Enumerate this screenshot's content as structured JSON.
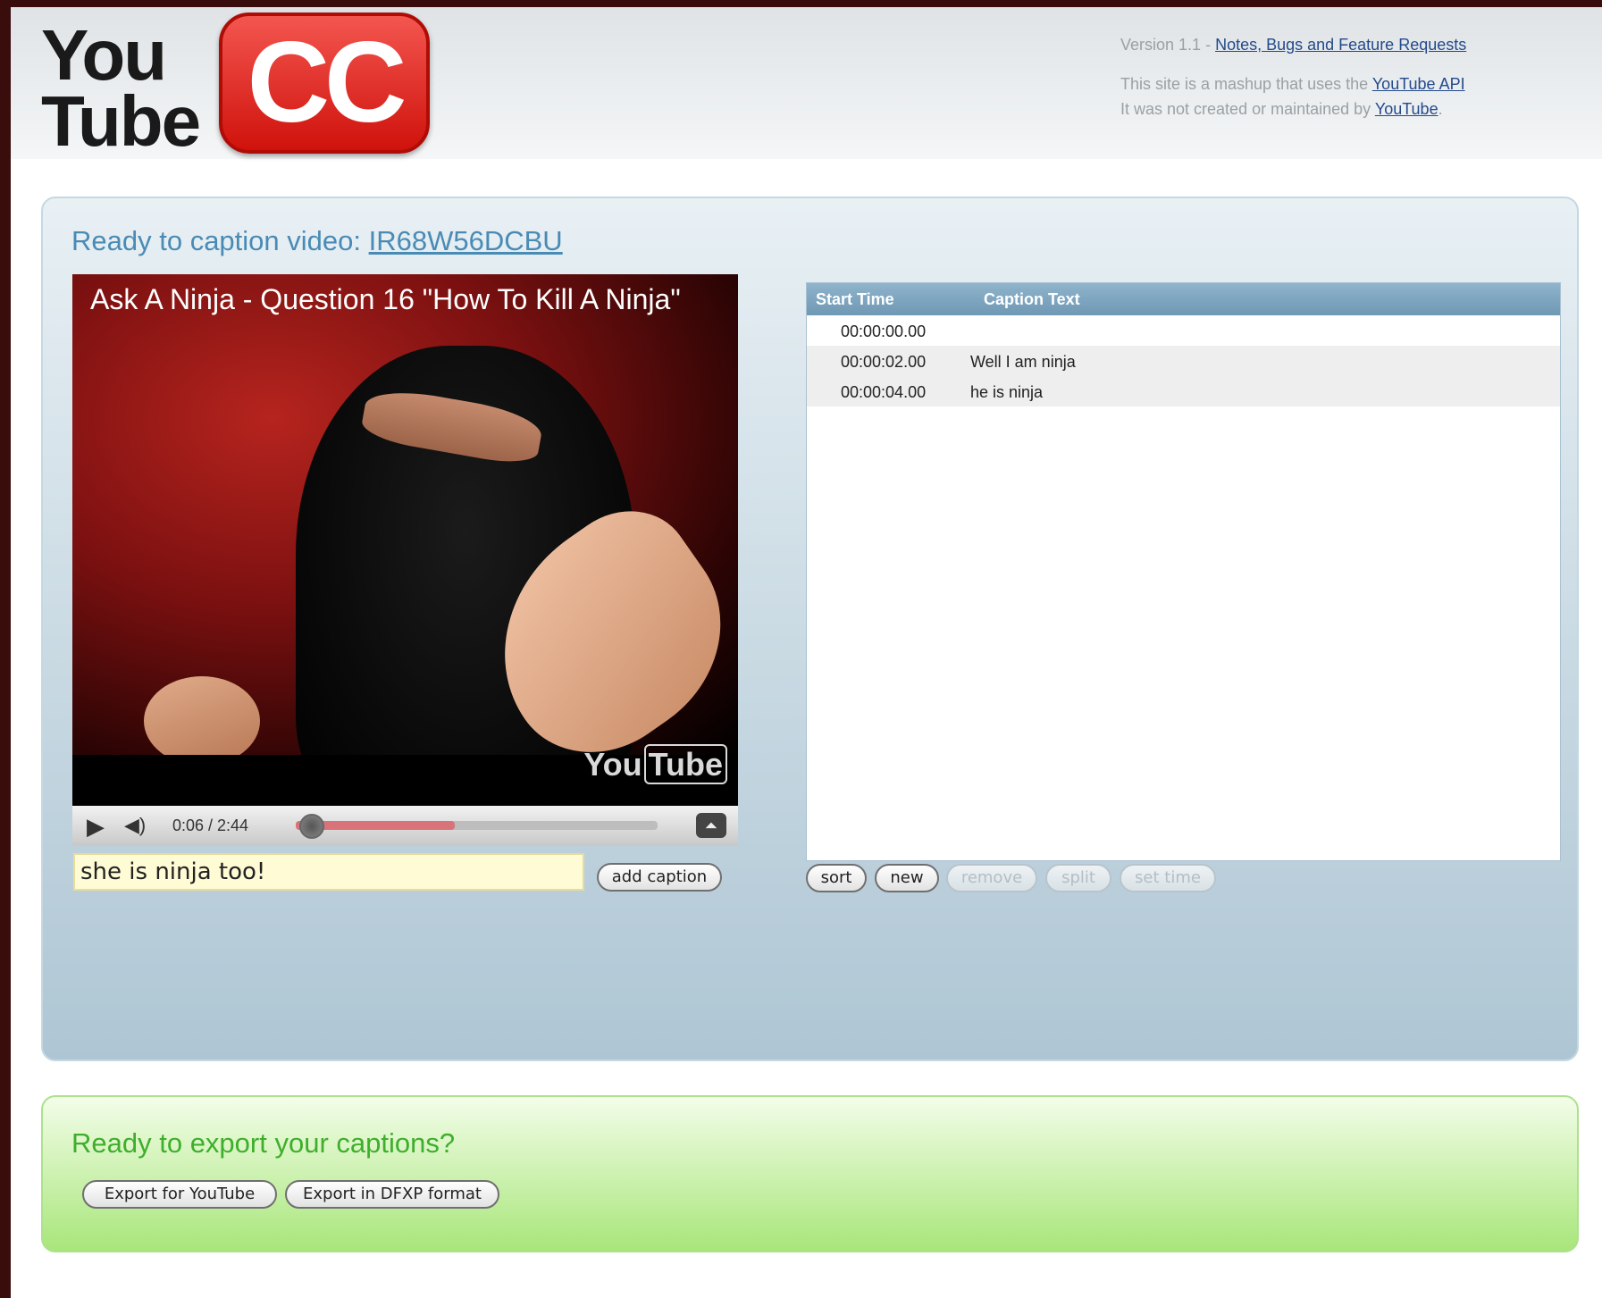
{
  "logo": {
    "you": "You",
    "tube": "Tube",
    "cc": "CC"
  },
  "header": {
    "version": "Version 1.1 -",
    "notes_link": "Notes, Bugs and Feature Requests",
    "mashup_text": "This site is a mashup that uses the",
    "api_link": "YouTube API",
    "maintained_text": "It was not created or maintained by",
    "youtube_link": "YouTube",
    "period": "."
  },
  "caption_panel": {
    "title_prefix": "Ready to caption video:",
    "video_id": "IR68W56DCBU"
  },
  "video": {
    "title": "Ask A Ninja - Question 16 \"How To Kill A Ninja\"",
    "watermark_you": "You",
    "watermark_tube": "Tube",
    "time": "0:06 / 2:44",
    "progress_loaded": 0.44,
    "progress_played": 0.04
  },
  "caption_input": {
    "value": "she is ninja too!"
  },
  "buttons": {
    "add_caption": "add caption",
    "sort": "sort",
    "new": "new",
    "remove": "remove",
    "split": "split",
    "set_time": "set time"
  },
  "table": {
    "headers": {
      "start": "Start Time",
      "text": "Caption Text"
    },
    "rows": [
      {
        "start": "00:00:00.00",
        "text": ""
      },
      {
        "start": "00:00:02.00",
        "text": "Well I am ninja"
      },
      {
        "start": "00:00:04.00",
        "text": "he is ninja"
      }
    ]
  },
  "export_panel": {
    "title": "Ready to export your captions?",
    "youtube_button": "Export for YouTube",
    "dfxp_button": "Export in DFXP format"
  },
  "colors": {
    "background_frame": "#3a0d0d",
    "caption_title": "#4a8bb5",
    "export_title": "#3fae2c",
    "logo_cc": "#e0231c",
    "table_header": "#7aa3be"
  },
  "icons": [
    "play-icon",
    "volume-icon",
    "fullscreen-icon"
  ]
}
